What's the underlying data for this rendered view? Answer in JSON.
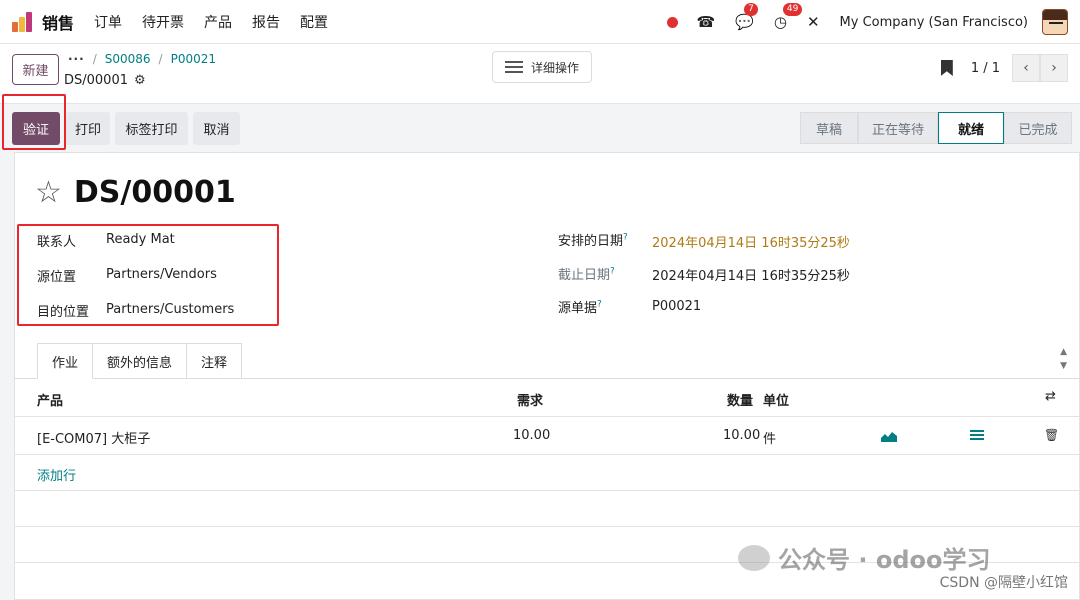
{
  "navbar": {
    "app_name": "销售",
    "menu": [
      "订单",
      "待开票",
      "产品",
      "报告",
      "配置"
    ],
    "badge_chat": "7",
    "badge_activity": "49",
    "company": "My Company (San Francisco)"
  },
  "control": {
    "new_label": "新建",
    "breadcrumb_more": "···",
    "breadcrumb": [
      "S00086",
      "P00021"
    ],
    "breadcrumb_sep": "/",
    "record_name": "DS/00001",
    "actions_label": "详细操作",
    "pager": "1 / 1"
  },
  "statusbar": {
    "validate": "验证",
    "print": "打印",
    "label_print": "标签打印",
    "cancel": "取消",
    "stages": [
      "草稿",
      "正在等待",
      "就绪",
      "已完成"
    ],
    "active_stage": "就绪"
  },
  "form": {
    "title": "DS/00001",
    "contact_label": "联系人",
    "contact_value": "Ready Mat",
    "src_label": "源位置",
    "src_value": "Partners/Vendors",
    "dest_label": "目的位置",
    "dest_value": "Partners/Customers",
    "scheduled_label": "安排的日期",
    "scheduled_value": "2024年04月14日 16时35分25秒",
    "deadline_label": "截止日期",
    "deadline_value": "2024年04月14日 16时35分25秒",
    "origin_label": "源单据",
    "origin_value": "P00021",
    "help_mark": "?"
  },
  "tabs": [
    "作业",
    "额外的信息",
    "注释"
  ],
  "table": {
    "headers": {
      "product": "产品",
      "demand": "需求",
      "quantity": "数量",
      "unit": "单位"
    },
    "rows": [
      {
        "product": "[E-COM07] 大柜子",
        "demand": "10.00",
        "quantity": "10.00",
        "unit": "件"
      }
    ],
    "add_line": "添加行"
  },
  "watermark": {
    "text": "公众号 · odoo学习",
    "csdn": "CSDN @隔壁小红馆"
  },
  "colors": {
    "brand": "#714b67",
    "link": "#017e84",
    "highlight": "#e8262b"
  }
}
